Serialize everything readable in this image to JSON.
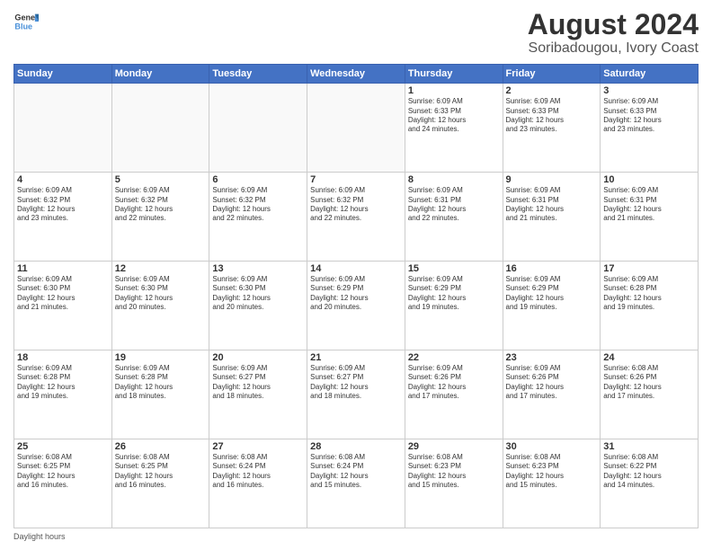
{
  "header": {
    "logo_line1": "General",
    "logo_line2": "Blue",
    "title": "August 2024",
    "subtitle": "Soribadougou, Ivory Coast"
  },
  "weekdays": [
    "Sunday",
    "Monday",
    "Tuesday",
    "Wednesday",
    "Thursday",
    "Friday",
    "Saturday"
  ],
  "weeks": [
    [
      {
        "day": "",
        "info": ""
      },
      {
        "day": "",
        "info": ""
      },
      {
        "day": "",
        "info": ""
      },
      {
        "day": "",
        "info": ""
      },
      {
        "day": "1",
        "info": "Sunrise: 6:09 AM\nSunset: 6:33 PM\nDaylight: 12 hours\nand 24 minutes."
      },
      {
        "day": "2",
        "info": "Sunrise: 6:09 AM\nSunset: 6:33 PM\nDaylight: 12 hours\nand 23 minutes."
      },
      {
        "day": "3",
        "info": "Sunrise: 6:09 AM\nSunset: 6:33 PM\nDaylight: 12 hours\nand 23 minutes."
      }
    ],
    [
      {
        "day": "4",
        "info": "Sunrise: 6:09 AM\nSunset: 6:32 PM\nDaylight: 12 hours\nand 23 minutes."
      },
      {
        "day": "5",
        "info": "Sunrise: 6:09 AM\nSunset: 6:32 PM\nDaylight: 12 hours\nand 22 minutes."
      },
      {
        "day": "6",
        "info": "Sunrise: 6:09 AM\nSunset: 6:32 PM\nDaylight: 12 hours\nand 22 minutes."
      },
      {
        "day": "7",
        "info": "Sunrise: 6:09 AM\nSunset: 6:32 PM\nDaylight: 12 hours\nand 22 minutes."
      },
      {
        "day": "8",
        "info": "Sunrise: 6:09 AM\nSunset: 6:31 PM\nDaylight: 12 hours\nand 22 minutes."
      },
      {
        "day": "9",
        "info": "Sunrise: 6:09 AM\nSunset: 6:31 PM\nDaylight: 12 hours\nand 21 minutes."
      },
      {
        "day": "10",
        "info": "Sunrise: 6:09 AM\nSunset: 6:31 PM\nDaylight: 12 hours\nand 21 minutes."
      }
    ],
    [
      {
        "day": "11",
        "info": "Sunrise: 6:09 AM\nSunset: 6:30 PM\nDaylight: 12 hours\nand 21 minutes."
      },
      {
        "day": "12",
        "info": "Sunrise: 6:09 AM\nSunset: 6:30 PM\nDaylight: 12 hours\nand 20 minutes."
      },
      {
        "day": "13",
        "info": "Sunrise: 6:09 AM\nSunset: 6:30 PM\nDaylight: 12 hours\nand 20 minutes."
      },
      {
        "day": "14",
        "info": "Sunrise: 6:09 AM\nSunset: 6:29 PM\nDaylight: 12 hours\nand 20 minutes."
      },
      {
        "day": "15",
        "info": "Sunrise: 6:09 AM\nSunset: 6:29 PM\nDaylight: 12 hours\nand 19 minutes."
      },
      {
        "day": "16",
        "info": "Sunrise: 6:09 AM\nSunset: 6:29 PM\nDaylight: 12 hours\nand 19 minutes."
      },
      {
        "day": "17",
        "info": "Sunrise: 6:09 AM\nSunset: 6:28 PM\nDaylight: 12 hours\nand 19 minutes."
      }
    ],
    [
      {
        "day": "18",
        "info": "Sunrise: 6:09 AM\nSunset: 6:28 PM\nDaylight: 12 hours\nand 19 minutes."
      },
      {
        "day": "19",
        "info": "Sunrise: 6:09 AM\nSunset: 6:28 PM\nDaylight: 12 hours\nand 18 minutes."
      },
      {
        "day": "20",
        "info": "Sunrise: 6:09 AM\nSunset: 6:27 PM\nDaylight: 12 hours\nand 18 minutes."
      },
      {
        "day": "21",
        "info": "Sunrise: 6:09 AM\nSunset: 6:27 PM\nDaylight: 12 hours\nand 18 minutes."
      },
      {
        "day": "22",
        "info": "Sunrise: 6:09 AM\nSunset: 6:26 PM\nDaylight: 12 hours\nand 17 minutes."
      },
      {
        "day": "23",
        "info": "Sunrise: 6:09 AM\nSunset: 6:26 PM\nDaylight: 12 hours\nand 17 minutes."
      },
      {
        "day": "24",
        "info": "Sunrise: 6:08 AM\nSunset: 6:26 PM\nDaylight: 12 hours\nand 17 minutes."
      }
    ],
    [
      {
        "day": "25",
        "info": "Sunrise: 6:08 AM\nSunset: 6:25 PM\nDaylight: 12 hours\nand 16 minutes."
      },
      {
        "day": "26",
        "info": "Sunrise: 6:08 AM\nSunset: 6:25 PM\nDaylight: 12 hours\nand 16 minutes."
      },
      {
        "day": "27",
        "info": "Sunrise: 6:08 AM\nSunset: 6:24 PM\nDaylight: 12 hours\nand 16 minutes."
      },
      {
        "day": "28",
        "info": "Sunrise: 6:08 AM\nSunset: 6:24 PM\nDaylight: 12 hours\nand 15 minutes."
      },
      {
        "day": "29",
        "info": "Sunrise: 6:08 AM\nSunset: 6:23 PM\nDaylight: 12 hours\nand 15 minutes."
      },
      {
        "day": "30",
        "info": "Sunrise: 6:08 AM\nSunset: 6:23 PM\nDaylight: 12 hours\nand 15 minutes."
      },
      {
        "day": "31",
        "info": "Sunrise: 6:08 AM\nSunset: 6:22 PM\nDaylight: 12 hours\nand 14 minutes."
      }
    ]
  ],
  "footer": "Daylight hours"
}
